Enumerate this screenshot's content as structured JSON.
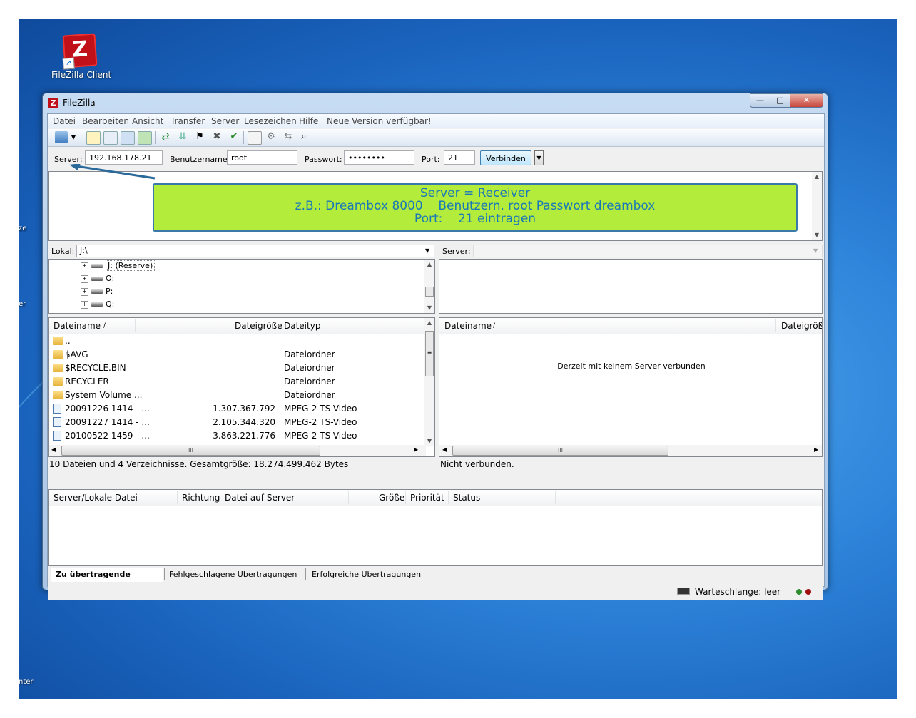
{
  "desktop": {
    "icon_label": "FileZilla Client",
    "icon_glyph": "Z",
    "edge_labels": [
      "ze",
      "er",
      "nter"
    ]
  },
  "window": {
    "title": "FileZilla",
    "minimize_glyph": "—",
    "maximize_glyph": "□",
    "close_glyph": "✕"
  },
  "menu": [
    "Datei",
    "Bearbeiten",
    "Ansicht",
    "Transfer",
    "Server",
    "Lesezeichen",
    "Hilfe",
    "Neue Version verfügbar!"
  ],
  "quickconnect": {
    "server_label": "Server:",
    "server_value": "192.168.178.21",
    "user_label": "Benutzername:",
    "user_value": "root",
    "pass_label": "Passwort:",
    "pass_value": "••••••••",
    "port_label": "Port:",
    "port_value": "21",
    "connect_label": "Verbinden"
  },
  "annotation": {
    "line1": "Server = Receiver",
    "line2": "z.B.: Dreambox 8000    Benutzern. root Passwort dreambox",
    "line3": "Port:    21 eintragen",
    "colors": {
      "fill": "#b3ec3b",
      "border": "#3b7aa8",
      "text": "#1a78b8"
    }
  },
  "local": {
    "path_label": "Lokal:",
    "path_value": "J:\\",
    "tree": [
      {
        "label": "J: (Reserve)"
      },
      {
        "label": "O:"
      },
      {
        "label": "P:"
      },
      {
        "label": "Q:"
      }
    ],
    "columns": [
      "Dateiname",
      "/",
      "Dateigröße",
      "Dateityp"
    ],
    "files": [
      {
        "name": "..",
        "size": "",
        "type": "",
        "kind": "folder"
      },
      {
        "name": "$AVG",
        "size": "",
        "type": "Dateiordner",
        "kind": "folder"
      },
      {
        "name": "$RECYCLE.BIN",
        "size": "",
        "type": "Dateiordner",
        "kind": "folder"
      },
      {
        "name": "RECYCLER",
        "size": "",
        "type": "Dateiordner",
        "kind": "folder"
      },
      {
        "name": "System Volume ...",
        "size": "",
        "type": "Dateiordner",
        "kind": "folder"
      },
      {
        "name": "20091226 1414 - ...",
        "size": "1.307.367.792",
        "type": "MPEG-2 TS-Video",
        "kind": "file"
      },
      {
        "name": "20091227 1414 - ...",
        "size": "2.105.344.320",
        "type": "MPEG-2 TS-Video",
        "kind": "file"
      },
      {
        "name": "20100522 1459 - ...",
        "size": "3.863.221.776",
        "type": "MPEG-2 TS-Video",
        "kind": "file"
      }
    ],
    "status": "10 Dateien und 4 Verzeichnisse. Gesamtgröße: 18.274.499.462 Bytes"
  },
  "remote": {
    "path_label": "Server:",
    "columns": [
      "Dateiname",
      "/",
      "Dateigröße"
    ],
    "empty_message": "Derzeit mit keinem Server verbunden",
    "status": "Nicht verbunden."
  },
  "queue": {
    "columns": [
      "Server/Lokale Datei",
      "Richtung",
      "Datei auf Server",
      "Größe",
      "Priorität",
      "Status"
    ],
    "tabs": [
      "Zu übertragende Dateien",
      "Fehlgeschlagene Übertragungen",
      "Erfolgreiche Übertragungen"
    ]
  },
  "statusbar": {
    "queue_text": "Warteschlange: leer",
    "led_colors": [
      "#2e8b2e",
      "#a01010"
    ]
  }
}
